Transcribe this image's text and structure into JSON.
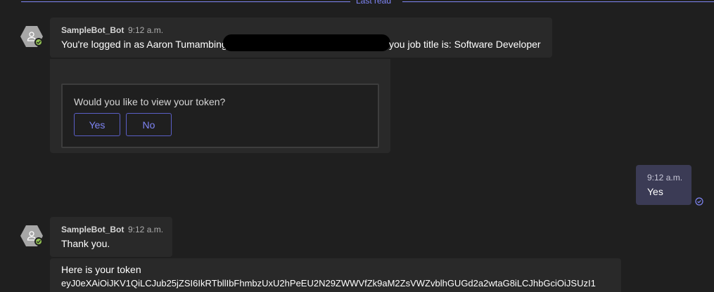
{
  "divider": {
    "label": "Last read"
  },
  "messages": [
    {
      "sender": "SampleBot_Bot",
      "time": "9:12 a.m.",
      "text_before": "You're logged in as Aaron Tumambing",
      "text_after": "you job title is: Software Developer"
    }
  ],
  "card": {
    "question": "Would you like to view your token?",
    "yes_label": "Yes",
    "no_label": "No"
  },
  "own_message": {
    "time": "9:12 a.m.",
    "text": "Yes"
  },
  "second_message": {
    "sender": "SampleBot_Bot",
    "time": "9:12 a.m.",
    "text": "Thank you."
  },
  "token_message": {
    "line1": "Here is your token",
    "line2": "eyJ0eXAiOiJKV1QiLCJub25jZSI6IkRTbllIbFhmbzUxU2hPeEU2N29ZWWVfZk9aM2ZsVWZvblhGUGd2a2wtaG8iLCJhbGciOiJSUzI1"
  },
  "colors": {
    "accent": "#7f85f5",
    "presence": "#92c353",
    "background": "#1f1f1f",
    "bubble": "#292929"
  }
}
